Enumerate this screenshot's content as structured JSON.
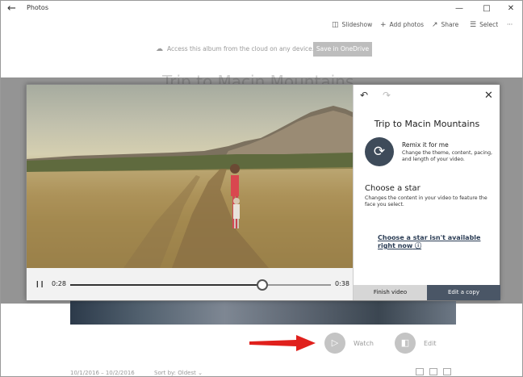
{
  "app": {
    "title": "Photos"
  },
  "toolbar": {
    "slideshow": "Slideshow",
    "add_photos": "Add photos",
    "share": "Share",
    "select": "Select",
    "more": "···"
  },
  "cloud": {
    "notice": "Access this album from the cloud on any device.",
    "save_button": "Save in OneDrive"
  },
  "album": {
    "title": "Trip to Macin Mountains"
  },
  "player": {
    "current_time": "0:28",
    "end_time": "0:38",
    "progress": 0.737
  },
  "panel": {
    "title": "Trip to Macin Mountains",
    "remix_title": "Remix it for me",
    "remix_desc": "Change the theme, content, pacing, and length of your video.",
    "star_title": "Choose a star",
    "star_desc": "Changes the content in your video to feature the face you select.",
    "star_link": "Choose a star isn't available right now",
    "finish_button": "Finish video",
    "copy_button": "Edit a copy"
  },
  "actions": {
    "watch": "Watch",
    "edit": "Edit"
  },
  "footer": {
    "date_range": "10/1/2016 – 10/2/2016",
    "sort_label": "Sort by:",
    "sort_value": "Oldest"
  },
  "colors": {
    "accent_dark": "#4a5666",
    "remix_circle": "#3e4b5a",
    "arrow": "#e0201c"
  }
}
